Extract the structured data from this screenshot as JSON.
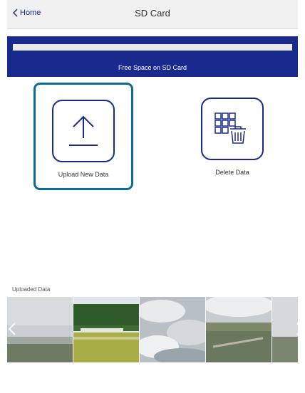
{
  "header": {
    "back_label": "Home",
    "title": "SD Card"
  },
  "storage": {
    "label": "Free Space on SD Card",
    "free_fraction": 1.0
  },
  "actions": {
    "upload_label": "Upload New Data",
    "delete_label": "Delete Data"
  },
  "gallery": {
    "label": "Uploaded Data"
  },
  "colors": {
    "brand": "#1a2a8c",
    "selected_border": "#0b6a9a"
  }
}
